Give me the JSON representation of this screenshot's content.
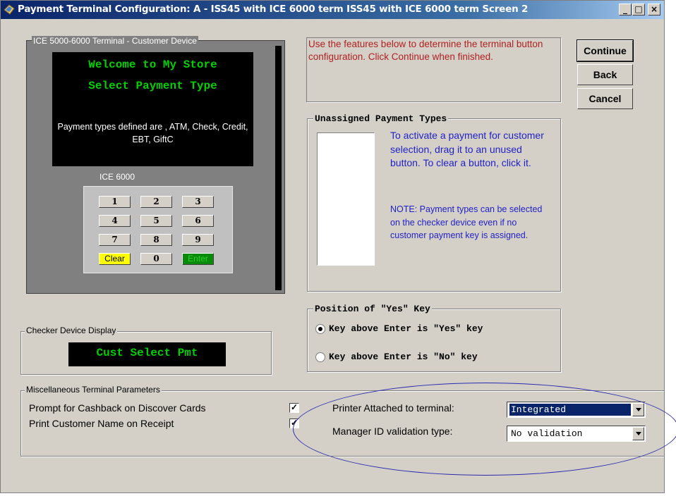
{
  "window": {
    "title": "Payment Terminal Configuration: A - ISS45 with ICE 6000 term ISS45 with ICE 6000 term  Screen 2",
    "minimize_glyph": "_",
    "maximize_glyph": "□",
    "close_glyph": "×",
    "icon": "card-icon"
  },
  "customer_device": {
    "group_label": "ICE 5000-6000 Terminal - Customer Device",
    "screen_line1": "Welcome to My Store",
    "screen_line2": "Select Payment Type",
    "screen_info": "Payment types defined are , ATM, Check, Credit, EBT, GiftC",
    "model": "ICE 6000",
    "keys": [
      "1",
      "2",
      "3",
      "4",
      "5",
      "6",
      "7",
      "8",
      "9",
      "Clear",
      "0",
      "Enter"
    ]
  },
  "instructions": "Use the features below to determine the terminal button configuration.  Click Continue when finished.",
  "buttons": {
    "continue": "Continue",
    "back": "Back",
    "cancel": "Cancel"
  },
  "unassigned": {
    "title": "Unassigned Payment Types",
    "info": "To activate a payment for customer selection, drag it to an unused button.  To clear a button, click it.",
    "note": "NOTE: Payment types can be selected on the checker device even if no customer payment key is assigned.",
    "items": []
  },
  "yes_key": {
    "title": "Position of \"Yes\" Key",
    "option_above_yes": "Key above Enter is \"Yes\" key",
    "option_above_no": "Key above Enter is \"No\" key",
    "selected": "option_above_yes"
  },
  "checker_display": {
    "group_label": "Checker Device Display",
    "text": "Cust Select Pmt"
  },
  "misc": {
    "group_label": "Miscellaneous Terminal Parameters",
    "cashback_label": "Prompt for Cashback on Discover Cards",
    "cashback_checked": true,
    "name_on_receipt_label": "Print Customer Name on Receipt",
    "name_on_receipt_checked": true,
    "printer_label": "Printer Attached to terminal:",
    "printer_value": "Integrated",
    "manager_label": "Manager ID validation type:",
    "manager_value": "No validation"
  },
  "colors": {
    "instruction_text": "#b02020",
    "info_text": "#1f1fc8",
    "lcd_green": "#00d000",
    "annotation_ellipse": "#2a2ab0"
  }
}
